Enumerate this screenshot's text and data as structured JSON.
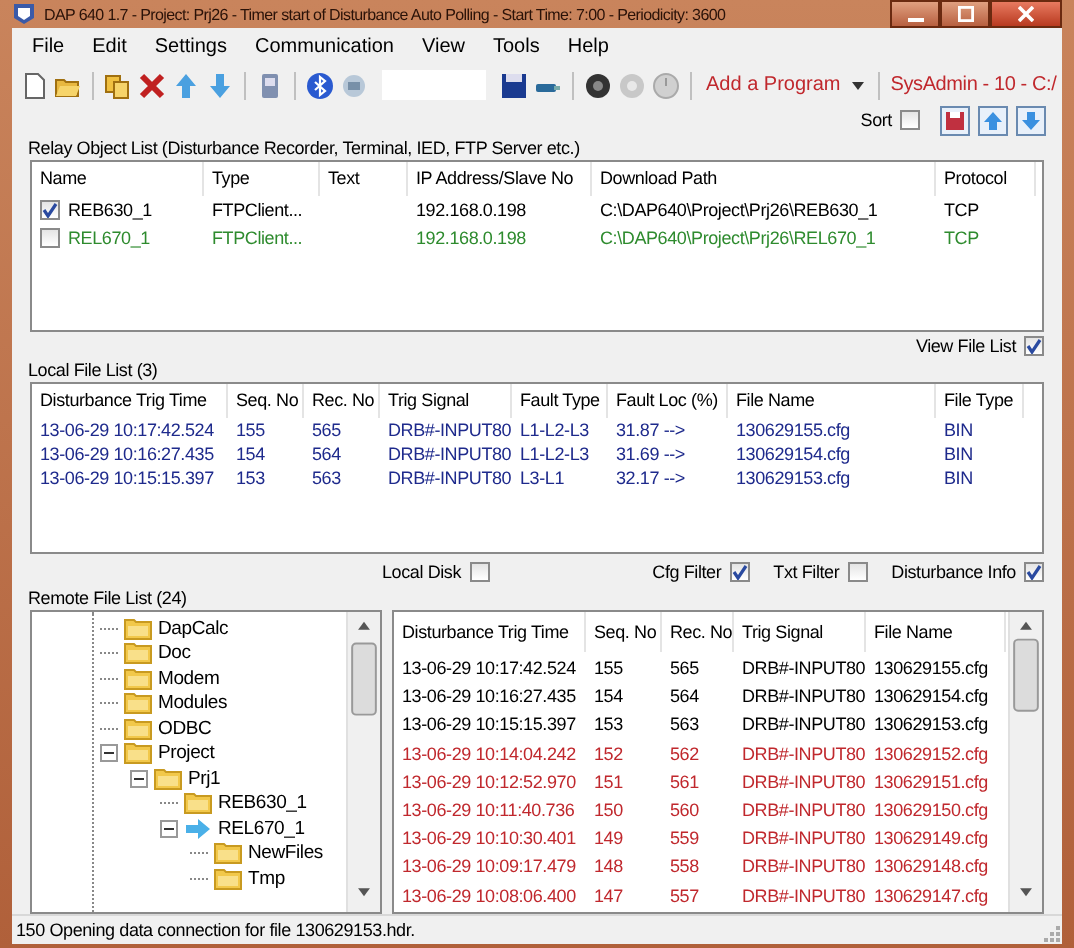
{
  "window": {
    "title": "DAP 640 1.7 - Project: Prj26  - Timer start of Disturbance Auto Polling - Start Time: 7:00 - Periodicity: 3600"
  },
  "menu": [
    "File",
    "Edit",
    "Settings",
    "Communication",
    "View",
    "Tools",
    "Help"
  ],
  "toolbar": {
    "program_button": "Add a Program",
    "user_label": "SysAdmin - 10 - C:/"
  },
  "sort": {
    "label": "Sort",
    "checked": false
  },
  "relay_list": {
    "title": "Relay Object List  (Disturbance Recorder, Terminal, IED, FTP Server etc.)",
    "columns": [
      "Name",
      "Type",
      "Text",
      "IP Address/Slave No",
      "Download Path",
      "Protocol"
    ],
    "rows": [
      {
        "checked": true,
        "color": "#000000",
        "cells": [
          "REB630_1",
          "FTPClient...",
          "",
          "192.168.0.198",
          "C:\\DAP640\\Project\\Prj26\\REB630_1",
          "TCP"
        ]
      },
      {
        "checked": false,
        "color": "#2e8b2e",
        "cells": [
          "REL670_1",
          "FTPClient...",
          "",
          "192.168.0.198",
          "C:\\DAP640\\Project\\Prj26\\REL670_1",
          "TCP"
        ]
      }
    ]
  },
  "view_file_list": {
    "label": "View File List",
    "checked": true
  },
  "local_list": {
    "title": "Local File List (3)",
    "columns": [
      "Disturbance Trig Time",
      "Seq. No",
      "Rec. No",
      "Trig Signal",
      "Fault Type",
      "Fault Loc (%)",
      "File Name",
      "File Type"
    ],
    "rows": [
      [
        "13-06-29 10:17:42.524",
        "155",
        "565",
        "DRB#-INPUT80",
        "L1-L2-L3",
        "31.87  -->",
        "130629155.cfg",
        "BIN"
      ],
      [
        "13-06-29 10:16:27.435",
        "154",
        "564",
        "DRB#-INPUT80",
        "L1-L2-L3",
        "31.69  -->",
        "130629154.cfg",
        "BIN"
      ],
      [
        "13-06-29 10:15:15.397",
        "153",
        "563",
        "DRB#-INPUT80",
        "L3-L1",
        "32.17  -->",
        "130629153.cfg",
        "BIN"
      ]
    ]
  },
  "local_disk": {
    "label": "Local Disk",
    "checked": false
  },
  "filters": [
    {
      "label": "Cfg Filter",
      "checked": true
    },
    {
      "label": "Txt Filter",
      "checked": false
    },
    {
      "label": "Disturbance Info",
      "checked": true
    }
  ],
  "remote_tree": {
    "title": "Remote File List (24)",
    "items": [
      {
        "label": "DapCalc",
        "kind": "folder"
      },
      {
        "label": "Doc",
        "kind": "folder"
      },
      {
        "label": "Modem",
        "kind": "folder"
      },
      {
        "label": "Modules",
        "kind": "folder"
      },
      {
        "label": "ODBC",
        "kind": "folder"
      },
      {
        "label": "Project",
        "kind": "folder",
        "expanded": true,
        "children": [
          {
            "label": "Prj1",
            "kind": "folder",
            "expanded": true,
            "children": [
              {
                "label": "REB630_1",
                "kind": "folder"
              },
              {
                "label": "REL670_1",
                "kind": "current",
                "expanded": true,
                "children": [
                  {
                    "label": "NewFiles",
                    "kind": "folder"
                  },
                  {
                    "label": "Tmp",
                    "kind": "folder"
                  }
                ]
              }
            ]
          }
        ]
      }
    ]
  },
  "remote_list": {
    "columns": [
      "Disturbance Trig Time",
      "Seq. No",
      "Rec. No",
      "Trig Signal",
      "File Name"
    ],
    "rows": [
      {
        "color": "#000000",
        "cells": [
          "13-06-29 10:17:42.524",
          "155",
          "565",
          "DRB#-INPUT80",
          "130629155.cfg"
        ]
      },
      {
        "color": "#000000",
        "cells": [
          "13-06-29 10:16:27.435",
          "154",
          "564",
          "DRB#-INPUT80",
          "130629154.cfg"
        ]
      },
      {
        "color": "#000000",
        "cells": [
          "13-06-29 10:15:15.397",
          "153",
          "563",
          "DRB#-INPUT80",
          "130629153.cfg"
        ]
      },
      {
        "color": "#c0282d",
        "cells": [
          "13-06-29 10:14:04.242",
          "152",
          "562",
          "DRB#-INPUT80",
          "130629152.cfg"
        ]
      },
      {
        "color": "#c0282d",
        "cells": [
          "13-06-29 10:12:52.970",
          "151",
          "561",
          "DRB#-INPUT80",
          "130629151.cfg"
        ]
      },
      {
        "color": "#c0282d",
        "cells": [
          "13-06-29 10:11:40.736",
          "150",
          "560",
          "DRB#-INPUT80",
          "130629150.cfg"
        ]
      },
      {
        "color": "#c0282d",
        "cells": [
          "13-06-29 10:10:30.401",
          "149",
          "559",
          "DRB#-INPUT80",
          "130629149.cfg"
        ]
      },
      {
        "color": "#c0282d",
        "cells": [
          "13-06-29 10:09:17.479",
          "148",
          "558",
          "DRB#-INPUT80",
          "130629148.cfg"
        ]
      },
      {
        "color": "#c0282d",
        "cells": [
          "13-06-29 10:08:06.400",
          "147",
          "557",
          "DRB#-INPUT80",
          "130629147.cfg"
        ]
      }
    ]
  },
  "status_bar": "150 Opening data connection for file 130629153.hdr."
}
